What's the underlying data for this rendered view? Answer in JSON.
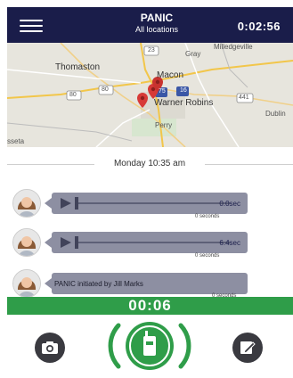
{
  "header": {
    "title": "PANIC",
    "subtitle": "All locations",
    "elapsed": "0:02:56"
  },
  "map": {
    "labels": {
      "milledgeville": "Milledgeville",
      "thomaston": "Thomaston",
      "macon": "Macon",
      "gray": "Gray",
      "warner_robins": "Warner Robins",
      "perry": "Perry",
      "dublin": "Dublin",
      "sseta": "sseta"
    },
    "route_shields": [
      "23",
      "75",
      "16",
      "80",
      "80",
      "441"
    ]
  },
  "date_separator": "Monday 10:35 am",
  "messages": [
    {
      "type": "audio",
      "duration": "0.0sec",
      "seconds_label": "0 seconds"
    },
    {
      "type": "audio",
      "duration": "6.4sec",
      "seconds_label": "0 seconds"
    },
    {
      "type": "text",
      "text": "PANIC initiated by Jill Marks",
      "seconds_label": "0 seconds"
    }
  ],
  "countdown": "00:06",
  "actions": {
    "camera": "camera-icon",
    "walkie": "walkie-talkie-icon",
    "compose": "compose-icon"
  },
  "colors": {
    "header_bg": "#1a1d4a",
    "bubble": "#8d8fa2",
    "green": "#2f9d49",
    "button_dark": "#3a3a40"
  }
}
